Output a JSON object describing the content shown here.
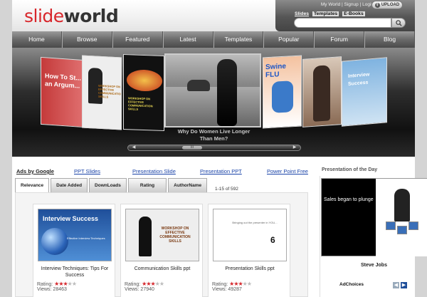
{
  "header": {
    "logo_part1": "slide",
    "logo_part2": "world",
    "account_links": [
      "My World",
      "Signup",
      "Login"
    ],
    "upload_label": "UPLOAD",
    "search_tabs": [
      "Slides",
      "Templates",
      "E-Books"
    ],
    "search_placeholder": ""
  },
  "nav": [
    "Home",
    "Browse",
    "Featured",
    "Latest",
    "Templates",
    "Popular",
    "Forum",
    "Blog"
  ],
  "carousel": {
    "caption_line1": "Why Do Women Live Longer",
    "caption_line2": "Than Men?",
    "slides": [
      {
        "text": "How To St... an Argum..."
      },
      {
        "text": "WORKSHOP ON EFFECTIVE COMMUNICATION SKILLS"
      },
      {
        "text": "WORKSHOP ON EFFECTIVE COMMUNICATION SKILLS"
      },
      {
        "text": ""
      },
      {
        "text": "Swine FLU"
      },
      {
        "text": ""
      },
      {
        "text": "Interview Success"
      }
    ],
    "scroll_thumb_label": "III"
  },
  "links": {
    "ads_label": "Ads by Google",
    "items": [
      "PPT Slides",
      "Presentation Slide",
      "Presentation PPT",
      "Power Point Free"
    ],
    "potd_label": "Presentation of the Day"
  },
  "tabs": [
    "Relevance",
    "Date Added",
    "DownLoads",
    "Rating",
    "AuthorName"
  ],
  "result_count": "1-15 of 592",
  "cards": [
    {
      "title": "Interview Techniques: Tips For Success",
      "thumb_title": "Interview Success",
      "thumb_sub": "Effective Interview Techniques",
      "rating_label": "Rating:",
      "stars": 3,
      "views": "Views: 28463"
    },
    {
      "title": "Communication Skills ppt",
      "thumb_title": "WORKSHOP ON EFFECTIVE COMMUNICATION SKILLS",
      "thumb_sub": "",
      "rating_label": "Rating:",
      "stars": 3,
      "views": "Views: 27940"
    },
    {
      "title": "Presentation Skills ppt",
      "thumb_title": "Bringing out the presenter in YOU...",
      "thumb_sub": "",
      "rating_label": "Rating:",
      "stars": 3,
      "views": "Views: 49287"
    }
  ],
  "potd": {
    "slide_text": "Sales began to plunge",
    "name": "Steve Jobs",
    "adchoices": "AdChoices",
    "prev": "◀",
    "next": "▶"
  },
  "colors": {
    "brand_red": "#d8262b",
    "link_blue": "#1a43a8",
    "star_on": "#d4252a",
    "star_off": "#bbbbbb"
  }
}
